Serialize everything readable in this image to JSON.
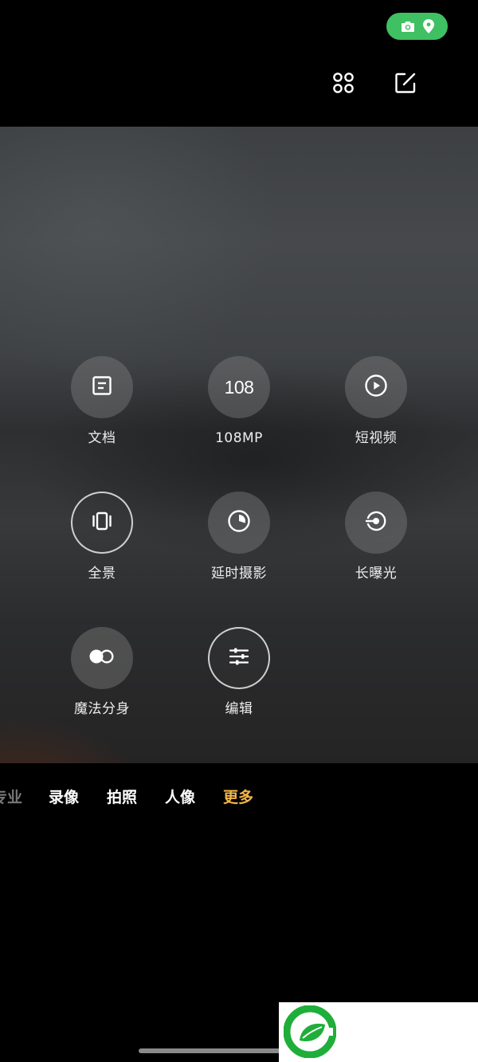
{
  "colors": {
    "status_pill": "#3fc063",
    "accent_active": "#f3b64a",
    "label_text": "#eeeeee",
    "logo_green": "#1fae3a"
  },
  "status_bar": {
    "icons": [
      "camera-icon",
      "location-pin-icon"
    ]
  },
  "toolbar": {
    "icons": [
      "grid-icon",
      "edit-icon"
    ]
  },
  "modes": [
    {
      "label": "文档",
      "icon": "document-icon"
    },
    {
      "label": "108MP",
      "icon_text": "108"
    },
    {
      "label": "短视频",
      "icon": "play-icon"
    },
    {
      "label": "全景",
      "icon": "panorama-icon"
    },
    {
      "label": "延时摄影",
      "icon": "timelapse-icon"
    },
    {
      "label": "长曝光",
      "icon": "long-exposure-icon"
    },
    {
      "label": "魔法分身",
      "icon": "clone-icon"
    },
    {
      "label": "编辑",
      "icon": "sliders-icon"
    }
  ],
  "mode_strip": {
    "tabs": [
      "专业",
      "录像",
      "拍照",
      "人像",
      "更多"
    ],
    "active": "更多"
  }
}
